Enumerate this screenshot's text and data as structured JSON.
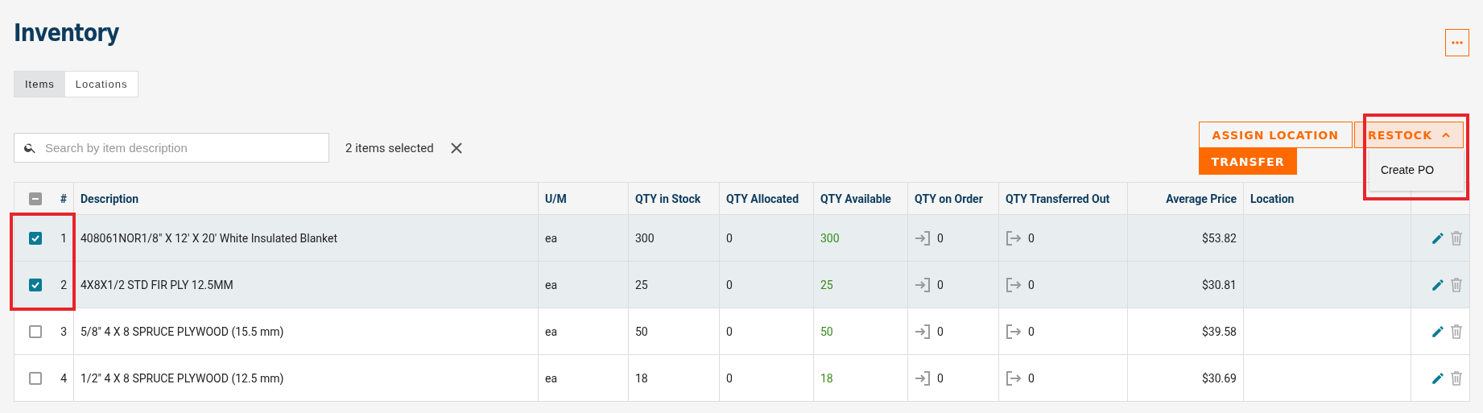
{
  "title": "Inventory",
  "tabs": [
    {
      "label": "Items",
      "selected": true
    },
    {
      "label": "Locations",
      "selected": false
    }
  ],
  "search": {
    "placeholder": "Search by item description"
  },
  "selection": {
    "text": "2 items selected"
  },
  "actions": {
    "assign": "ASSIGN LOCATION",
    "restock": "RESTOCK",
    "restock_expanded": true,
    "restock_highlighted": true,
    "transfer": "TRANSFER",
    "menu_items": [
      "Create PO"
    ]
  },
  "table": {
    "select_all_partial": true,
    "highlight_checked": true,
    "columns": [
      {
        "label": "#"
      },
      {
        "label": "Description"
      },
      {
        "label": "U/M"
      },
      {
        "label": "QTY in Stock"
      },
      {
        "label": "QTY Allocated"
      },
      {
        "label": "QTY Available"
      },
      {
        "label": "QTY on Order"
      },
      {
        "label": "QTY Transferred Out"
      },
      {
        "label": "Average Price"
      },
      {
        "label": "Location"
      }
    ],
    "rows": [
      {
        "checked": true,
        "number": "1",
        "description": "408061NOR1/8\" X 12' X 20' White Insulated Blanket",
        "um": "ea",
        "in_stock": "300",
        "allocated": "0",
        "available": "300",
        "on_order": "0",
        "transferred_out": "0",
        "average_price": "$53.82"
      },
      {
        "checked": true,
        "number": "2",
        "description": "4X8X1/2 STD FIR PLY 12.5MM",
        "um": "ea",
        "in_stock": "25",
        "allocated": "0",
        "available": "25",
        "on_order": "0",
        "transferred_out": "0",
        "average_price": "$30.81"
      },
      {
        "checked": false,
        "number": "3",
        "description": "5/8\" 4 X 8 SPRUCE PLYWOOD (15.5 mm)",
        "um": "ea",
        "in_stock": "50",
        "allocated": "0",
        "available": "50",
        "on_order": "0",
        "transferred_out": "0",
        "average_price": "$39.58"
      },
      {
        "checked": false,
        "number": "4",
        "description": "1/2\" 4 X 8 SPRUCE PLYWOOD (12.5 mm)",
        "um": "ea",
        "in_stock": "18",
        "allocated": "0",
        "available": "18",
        "on_order": "0",
        "transferred_out": "0",
        "average_price": "$30.69"
      }
    ]
  }
}
